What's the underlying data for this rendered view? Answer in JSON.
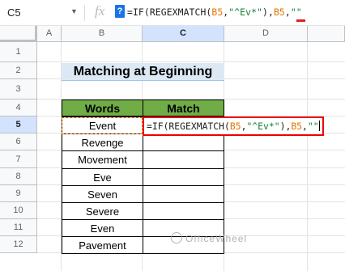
{
  "formula_bar": {
    "name_box": "C5",
    "name_box_arrow": "▼",
    "fx_icon": "fx",
    "help_icon": "?",
    "formula_tokens": [
      {
        "text": "=IF(REGEXMATCH(",
        "kind": "fn"
      },
      {
        "text": "B5",
        "kind": "ref"
      },
      {
        "text": ",",
        "kind": "fn"
      },
      {
        "text": "\"^Ev*\"",
        "kind": "str"
      },
      {
        "text": "),",
        "kind": "fn"
      },
      {
        "text": "B5",
        "kind": "ref"
      },
      {
        "text": ",",
        "kind": "fn"
      },
      {
        "text": "\"\"",
        "kind": "str"
      }
    ]
  },
  "columns": [
    "A",
    "B",
    "C",
    "D"
  ],
  "selected_column": "C",
  "rows": [
    "1",
    "2",
    "3",
    "4",
    "5",
    "6",
    "7",
    "8",
    "9",
    "10",
    "11",
    "12"
  ],
  "selected_row": "5",
  "title": "Matching at Beginning",
  "table": {
    "headers": [
      "Words",
      "Match"
    ],
    "words": [
      "Event",
      "Revenge",
      "Movement",
      "Eve",
      "Seven",
      "Severe",
      "Even",
      "Pavement"
    ]
  },
  "cell_c5_formula": "=IF(REGEXMATCH(B5,\"^Ev*\"),B5,\"\"",
  "watermark": "OfficeWheel",
  "colors": {
    "header_green": "#70ad47",
    "title_bg": "#dce9f5",
    "ref_orange": "#e37400",
    "string_green": "#188038",
    "highlight_red": "#e00000"
  }
}
